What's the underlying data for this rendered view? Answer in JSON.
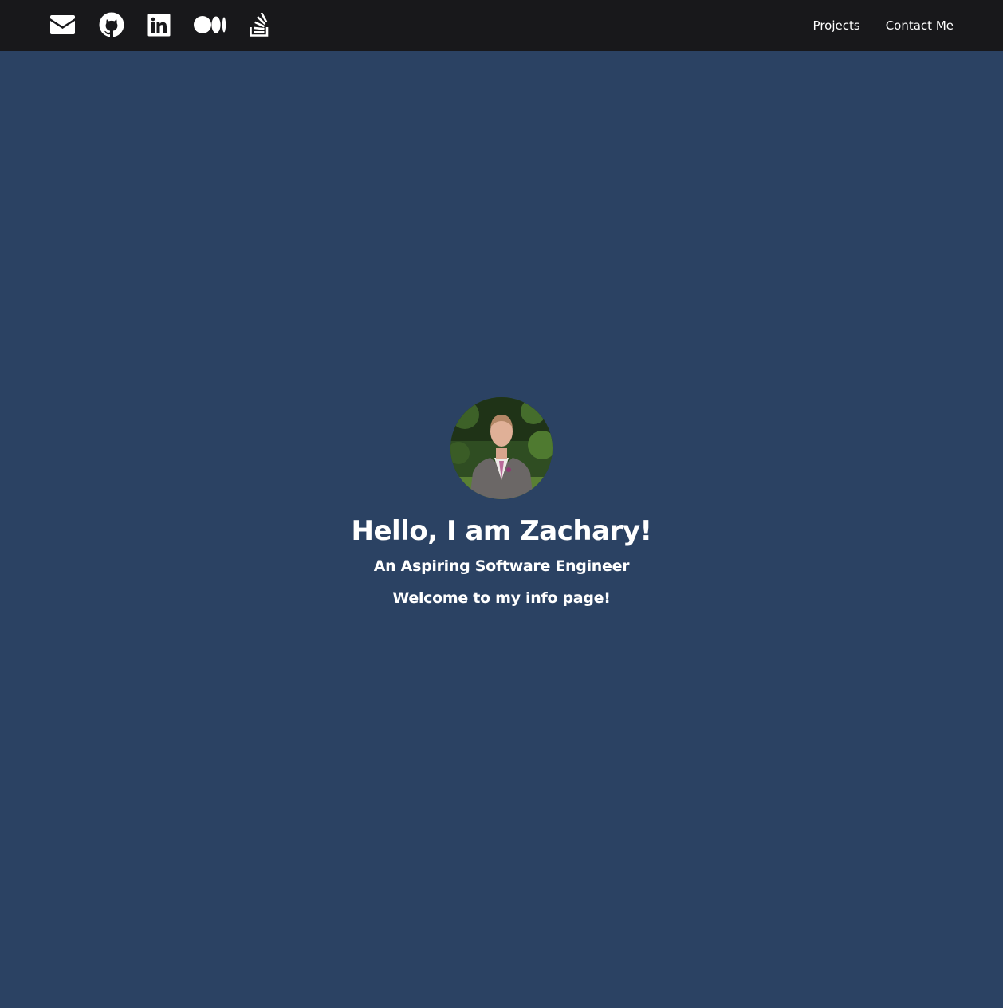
{
  "navbar": {
    "icons": [
      {
        "name": "envelope-icon"
      },
      {
        "name": "github-icon"
      },
      {
        "name": "linkedin-icon"
      },
      {
        "name": "medium-icon"
      },
      {
        "name": "stackoverflow-icon"
      }
    ],
    "links": [
      {
        "label": "Projects"
      },
      {
        "label": "Contact Me"
      }
    ]
  },
  "hero": {
    "title": "Hello, I am Zachary!",
    "subtitle": "An Aspiring Software Engineer",
    "welcome": "Welcome to my info page!"
  },
  "colors": {
    "navbar_bg": "#18181b",
    "page_bg": "#2b4263",
    "text": "#ffffff"
  }
}
